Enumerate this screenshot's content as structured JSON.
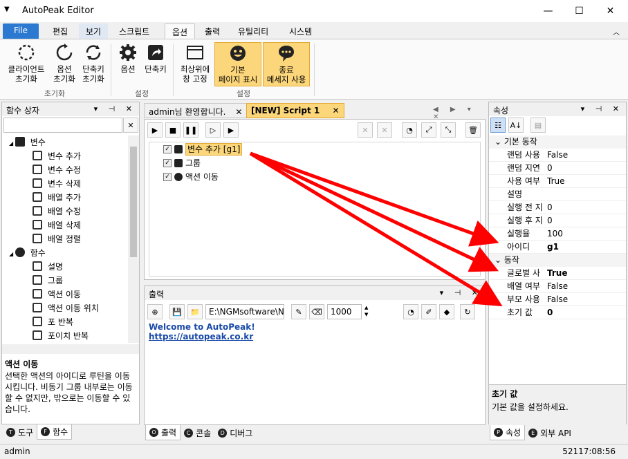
{
  "window": {
    "title": "AutoPeak Editor",
    "minimize": "—",
    "maximize": "☐",
    "close": "✕"
  },
  "menu_tabs": [
    "File",
    "편집",
    "보기",
    "스크립트",
    "옵션",
    "출력",
    "유틸리티",
    "시스템"
  ],
  "ribbon": {
    "groups": [
      {
        "label": "초기화",
        "buttons": [
          "클라이언트\n초기화",
          "옵션\n초기화",
          "단축키\n초기화"
        ]
      },
      {
        "label": "설정",
        "buttons": [
          "옵션",
          "단축키"
        ]
      },
      {
        "label": "설정",
        "buttons": [
          "최상위에\n창 고정",
          "기본\n페이지 표시",
          "종료\n메세지 사용"
        ]
      }
    ]
  },
  "left_panel": {
    "title": "함수 상자",
    "tree": [
      {
        "label": "변수",
        "level": 0,
        "icon": "variable-icon"
      },
      {
        "label": "변수 추가",
        "level": 1,
        "icon": "cube-icon"
      },
      {
        "label": "변수 수정",
        "level": 1,
        "icon": "cube-icon"
      },
      {
        "label": "변수 삭제",
        "level": 1,
        "icon": "cube-icon"
      },
      {
        "label": "배열 추가",
        "level": 1,
        "icon": "array-icon"
      },
      {
        "label": "배열 수정",
        "level": 1,
        "icon": "array-icon"
      },
      {
        "label": "배열 삭제",
        "level": 1,
        "icon": "array-icon"
      },
      {
        "label": "배열 정렬",
        "level": 1,
        "icon": "sort-icon"
      },
      {
        "label": "함수",
        "level": 0,
        "icon": "function-icon"
      },
      {
        "label": "설명",
        "level": 1,
        "icon": "comment-icon"
      },
      {
        "label": "그룹",
        "level": 1,
        "icon": "group-icon"
      },
      {
        "label": "액션 이동",
        "level": 1,
        "icon": "goto-icon"
      },
      {
        "label": "액션 이동 위치",
        "level": 1,
        "icon": "target-icon"
      },
      {
        "label": "포 반복",
        "level": 1,
        "icon": "loop-icon"
      },
      {
        "label": "포이치 반복",
        "level": 1,
        "icon": "loop-icon"
      }
    ],
    "desc_title": "액션 이동",
    "desc_text": "선택한 액션의 아이디로 루틴을 이동시킵니다. 비동기 그룹 내부로는 이동할 수 없지만, 밖으로는 이동할 수 있습니다.",
    "bottom_tabs": [
      {
        "badge": "T",
        "label": "도구"
      },
      {
        "badge": "F",
        "label": "함수"
      }
    ]
  },
  "doc_tabs": [
    {
      "label": "admin님 환영합니다."
    },
    {
      "label": "[NEW] Script 1"
    }
  ],
  "script_items": [
    {
      "label": "변수 추가 [g1]",
      "selected": true
    },
    {
      "label": "그룹",
      "selected": false
    },
    {
      "label": "액션 이동",
      "selected": false
    }
  ],
  "output_panel": {
    "title": "출력",
    "path": "E:\\NGMsoftware\\NG",
    "interval": "1000",
    "lines": [
      "Welcome to AutoPeak!",
      "https://autopeak.co.kr"
    ],
    "bottom_tabs": [
      {
        "badge": "O",
        "label": "출력"
      },
      {
        "badge": "C",
        "label": "콘솔"
      },
      {
        "badge": "D",
        "label": "디버그"
      }
    ]
  },
  "properties": {
    "title": "속성",
    "categories": [
      {
        "name": "기본 동작",
        "rows": [
          {
            "key": "랜덤 사용",
            "value": "False",
            "bold": false
          },
          {
            "key": "랜덤 지연",
            "value": "0",
            "bold": false
          },
          {
            "key": "사용 여부",
            "value": "True",
            "bold": false
          },
          {
            "key": "설명",
            "value": "",
            "bold": false
          },
          {
            "key": "실행 전 지",
            "value": "0",
            "bold": false
          },
          {
            "key": "실행 후 지",
            "value": "0",
            "bold": false
          },
          {
            "key": "실행율",
            "value": "100",
            "bold": false
          },
          {
            "key": "아이디",
            "value": "g1",
            "bold": true
          }
        ]
      },
      {
        "name": "동작",
        "rows": [
          {
            "key": "글로벌 사",
            "value": "True",
            "bold": true
          },
          {
            "key": "배열 여부",
            "value": "False",
            "bold": false
          },
          {
            "key": "부모 사용",
            "value": "False",
            "bold": false
          },
          {
            "key": "초기 값",
            "value": "0",
            "bold": true
          }
        ]
      }
    ],
    "desc_title": "초기 값",
    "desc_text": "기본 값을 설정하세요.",
    "bottom_tabs": [
      {
        "badge": "P",
        "label": "속성"
      },
      {
        "badge": "E",
        "label": "외부 API"
      }
    ]
  },
  "status": {
    "user": "admin",
    "time": "52117:08:56"
  },
  "colors": {
    "accent": "#2b79d0",
    "highlight": "#fcd67a",
    "arrow": "#ff0000"
  }
}
